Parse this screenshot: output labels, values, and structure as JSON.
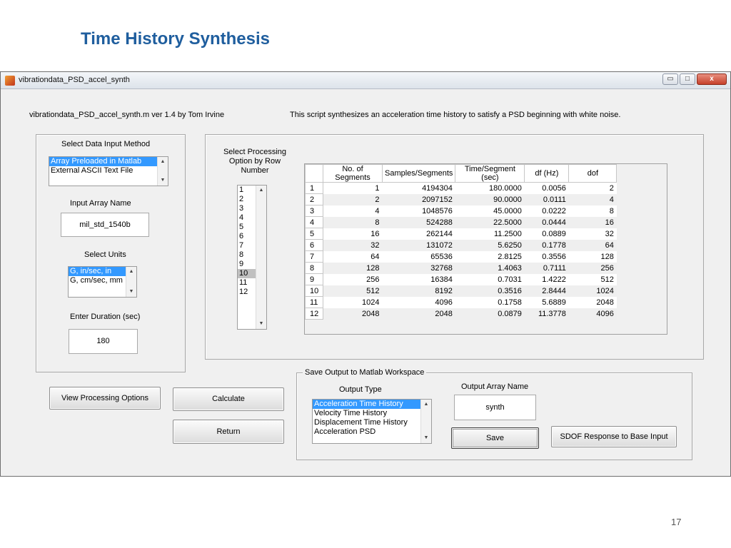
{
  "slide": {
    "title": "Time History Synthesis",
    "page_number": "17"
  },
  "window": {
    "title": "vibrationdata_PSD_accel_synth",
    "controls": {
      "minimize": "▭",
      "maximize": "□",
      "close": "x"
    }
  },
  "header": {
    "script_info": "vibrationdata_PSD_accel_synth.m  ver 1.4  by Tom Irvine",
    "description": "This script synthesizes an acceleration time history to satisfy a PSD beginning with white noise."
  },
  "left_panel": {
    "input_method_label": "Select Data Input Method",
    "input_method_options": [
      {
        "label": "Array Preloaded in Matlab",
        "selected": true
      },
      {
        "label": "External ASCII Text File",
        "selected": false
      }
    ],
    "input_array_label": "Input Array Name",
    "input_array_value": "mil_std_1540b",
    "units_label": "Select Units",
    "units_options": [
      {
        "label": "G, in/sec, in",
        "selected": true
      },
      {
        "label": "G, cm/sec, mm",
        "selected": false
      }
    ],
    "duration_label": "Enter Duration (sec)",
    "duration_value": "180"
  },
  "processing": {
    "label_line1": "Select Processing",
    "label_line2": "Option by Row",
    "label_line3": "Number",
    "rows": [
      "1",
      "2",
      "3",
      "4",
      "5",
      "6",
      "7",
      "8",
      "9",
      "10",
      "11",
      "12"
    ],
    "selected_row": "10"
  },
  "table": {
    "columns": [
      "No. of Segments",
      "Samples/Segments",
      "Time/Segment (sec)",
      "df (Hz)",
      "dof"
    ],
    "rows": [
      [
        "1",
        "1",
        "4194304",
        "180.0000",
        "0.0056",
        "2"
      ],
      [
        "2",
        "2",
        "2097152",
        "90.0000",
        "0.0111",
        "4"
      ],
      [
        "3",
        "4",
        "1048576",
        "45.0000",
        "0.0222",
        "8"
      ],
      [
        "4",
        "8",
        "524288",
        "22.5000",
        "0.0444",
        "16"
      ],
      [
        "5",
        "16",
        "262144",
        "11.2500",
        "0.0889",
        "32"
      ],
      [
        "6",
        "32",
        "131072",
        "5.6250",
        "0.1778",
        "64"
      ],
      [
        "7",
        "64",
        "65536",
        "2.8125",
        "0.3556",
        "128"
      ],
      [
        "8",
        "128",
        "32768",
        "1.4063",
        "0.7111",
        "256"
      ],
      [
        "9",
        "256",
        "16384",
        "0.7031",
        "1.4222",
        "512"
      ],
      [
        "10",
        "512",
        "8192",
        "0.3516",
        "2.8444",
        "1024"
      ],
      [
        "11",
        "1024",
        "4096",
        "0.1758",
        "5.6889",
        "2048"
      ],
      [
        "12",
        "2048",
        "2048",
        "0.0879",
        "11.3778",
        "4096"
      ]
    ]
  },
  "buttons": {
    "view_processing": "View Processing Options",
    "calculate": "Calculate",
    "return": "Return",
    "save": "Save",
    "sdof": "SDOF Response to Base Input"
  },
  "save_panel": {
    "title": "Save Output to Matlab Workspace",
    "output_type_label": "Output Type",
    "output_type_options": [
      {
        "label": "Acceleration Time History",
        "selected": true
      },
      {
        "label": "Velocity Time History",
        "selected": false
      },
      {
        "label": "Displacement Time History",
        "selected": false
      },
      {
        "label": "Acceleration PSD",
        "selected": false
      }
    ],
    "output_array_label": "Output Array Name",
    "output_array_value": "synth"
  },
  "colors": {
    "title_blue": "#1f5e9e",
    "selection_blue": "#3399ff",
    "window_bg": "#f0f0f0"
  }
}
